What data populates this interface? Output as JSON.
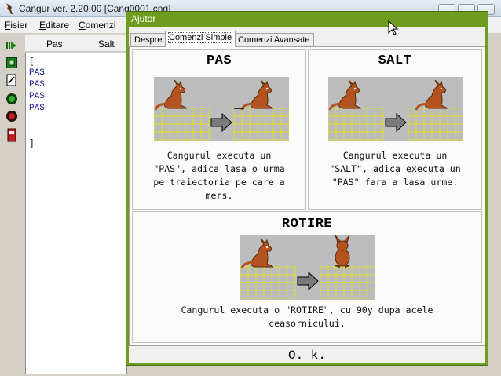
{
  "main": {
    "title": "Cangur ver. 2.20.00  [Cang0001.cng]",
    "menu": [
      "Fisier",
      "Editare",
      "Comenzi"
    ],
    "columns": [
      "Pas",
      "Salt"
    ],
    "code": [
      "[",
      "PAS",
      "PAS",
      "PAS",
      "PAS",
      "]"
    ]
  },
  "dialog": {
    "title": "Ajutor",
    "tabs": [
      "Despre",
      "Comenzi Simple",
      "Comenzi Avansate"
    ],
    "cards": {
      "pas": {
        "title": "PAS",
        "desc": [
          "Cangurul executa un",
          "\"PAS\", adica lasa o urma",
          "pe traiectoria pe care a",
          "mers."
        ]
      },
      "salt": {
        "title": "SALT",
        "desc": [
          "Cangurul executa un",
          "\"SALT\", adica executa un",
          "\"PAS\" fara a lasa urme."
        ]
      },
      "rotire": {
        "title": "ROTIRE",
        "desc": [
          "Cangurul executa o \"ROTIRE\", cu 90y dupa acele",
          "ceasornicului."
        ]
      }
    },
    "ok_label": "O. k."
  },
  "colors": {
    "dialog_frame": "#6e9c1e",
    "grid_line": "#e6e600",
    "kangaroo": "#b4531f",
    "code_text": "#1a1a9a"
  }
}
